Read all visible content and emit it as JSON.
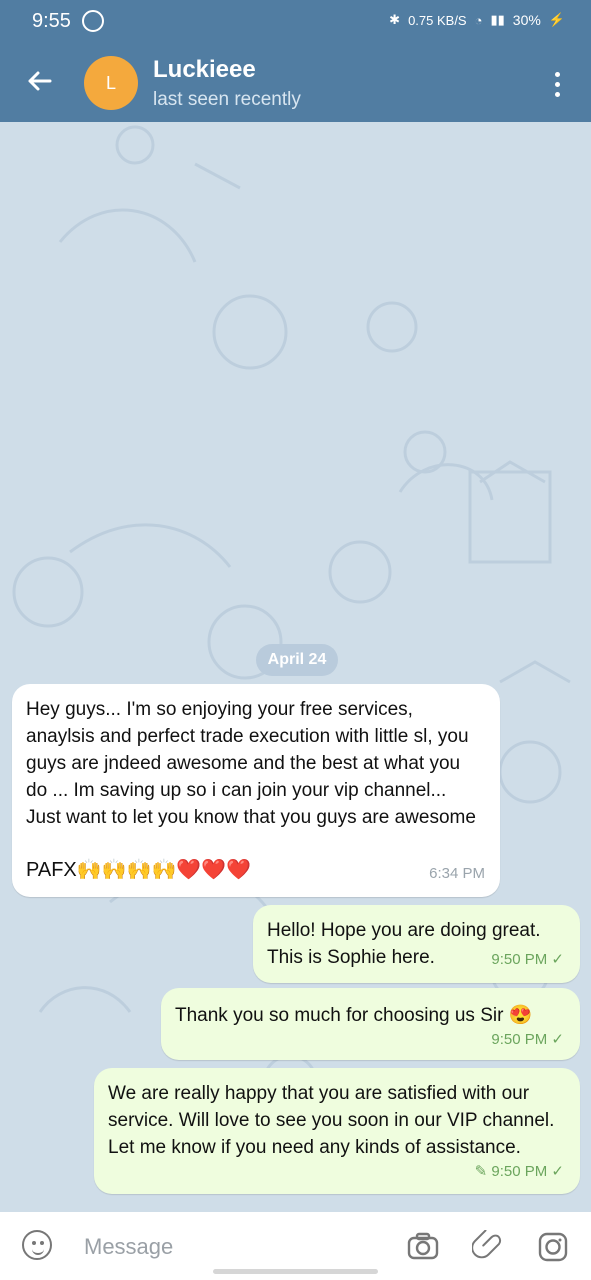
{
  "status": {
    "time": "9:55",
    "network_speed": "0.75 KB/S",
    "battery": "30%"
  },
  "header": {
    "avatar_letter": "L",
    "name": "Luckieee",
    "subtitle": "last seen recently"
  },
  "chat": {
    "date_chip": "April 24",
    "messages": [
      {
        "direction": "incoming",
        "text": "Hey guys... I'm so enjoying your free services, anaylsis and perfect trade execution with little sl, you guys are jndeed awesome and the best at what you do ... Im saving up so i can join your vip channel... Just want to let you know that you guys are awesome",
        "text_line2": "PAFX🙌🙌🙌🙌❤️❤️❤️",
        "time": "6:34 PM"
      },
      {
        "direction": "outgoing",
        "text": "Hello! Hope you are doing great. This is Sophie here.",
        "time": "9:50 PM ✓"
      },
      {
        "direction": "outgoing",
        "text": "Thank you so much for choosing us Sir 😍",
        "time": "9:50 PM ✓"
      },
      {
        "direction": "outgoing",
        "text": "We are really happy that you are satisfied with our service. Will love to see you soon in our VIP channel. Let me know if you need any kinds of assistance.",
        "time": "✎ 9:50 PM ✓"
      }
    ]
  },
  "input": {
    "placeholder": "Message"
  },
  "icons": {
    "back": "arrow-left-icon",
    "menu": "more-vertical-icon",
    "emoji": "emoji-icon",
    "camera": "camera-icon",
    "attach": "paperclip-icon",
    "instagram": "instagram-icon"
  }
}
